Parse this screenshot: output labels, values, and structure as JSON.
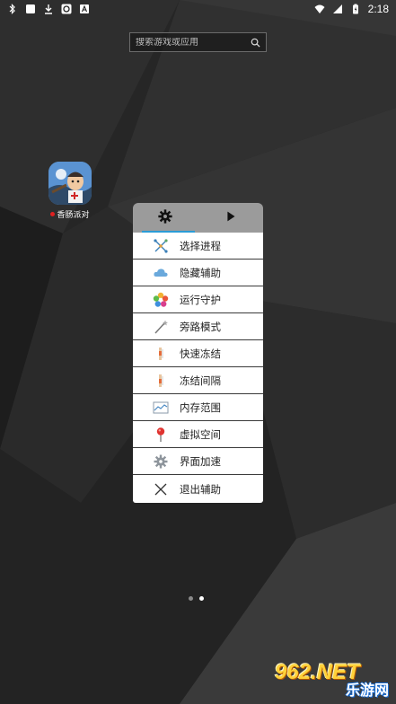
{
  "status_bar": {
    "left_icons": [
      "bluetooth-icon",
      "white-square-icon",
      "download-icon",
      "vpn-badge-icon",
      "a-badge-icon"
    ],
    "time": "2:18"
  },
  "search": {
    "placeholder": "搜索游戏或应用"
  },
  "app": {
    "label": "香肠派对"
  },
  "menu": {
    "tabs": [
      "gear-icon",
      "play-icon"
    ],
    "items": [
      {
        "label": "选择进程",
        "icon": "process-icon"
      },
      {
        "label": "隐藏辅助",
        "icon": "cloud-icon"
      },
      {
        "label": "运行守护",
        "icon": "flower-icon"
      },
      {
        "label": "旁路模式",
        "icon": "wand-icon"
      },
      {
        "label": "快速冻结",
        "icon": "freeze-icon"
      },
      {
        "label": "冻结间隔",
        "icon": "freeze-interval-icon"
      },
      {
        "label": "内存范围",
        "icon": "memory-chart-icon"
      },
      {
        "label": "虚拟空间",
        "icon": "pin-icon"
      },
      {
        "label": "界面加速",
        "icon": "cog-icon"
      },
      {
        "label": "退出辅助",
        "icon": "close-icon"
      }
    ]
  },
  "page_indicator": {
    "total": 2,
    "active": 2
  },
  "watermark": {
    "main": "962.NET",
    "sub": "乐游网"
  }
}
